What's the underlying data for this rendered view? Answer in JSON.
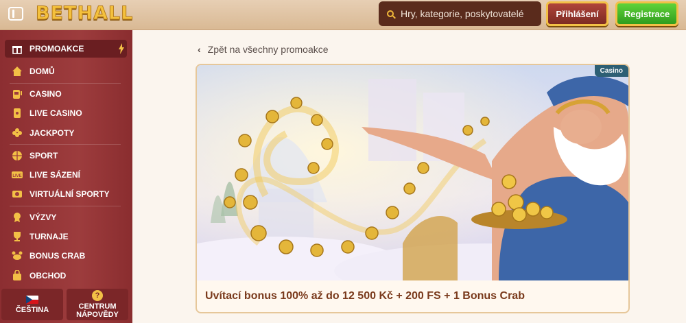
{
  "header": {
    "logo": "BETHALL",
    "search_placeholder": "Hry, kategorie, poskytovatelé",
    "login_label": "Přihlášení",
    "register_label": "Registrace"
  },
  "sidebar": {
    "items": [
      {
        "label": "PROMOAKCE",
        "icon": "gift-icon"
      },
      {
        "label": "DOMŮ",
        "icon": "home-icon"
      },
      {
        "label": "CASINO",
        "icon": "slot-machine-icon"
      },
      {
        "label": "LIVE CASINO",
        "icon": "cards-icon"
      },
      {
        "label": "JACKPOTY",
        "icon": "clover-icon"
      },
      {
        "label": "SPORT",
        "icon": "ball-icon"
      },
      {
        "label": "LIVE SÁZENÍ",
        "icon": "live-icon"
      },
      {
        "label": "VIRTUÁLNÍ SPORTY",
        "icon": "virtual-icon"
      },
      {
        "label": "VÝZVY",
        "icon": "challenge-icon"
      },
      {
        "label": "TURNAJE",
        "icon": "trophy-icon"
      },
      {
        "label": "BONUS CRAB",
        "icon": "crab-icon"
      },
      {
        "label": "OBCHOD",
        "icon": "bag-icon"
      }
    ],
    "language_label": "ČEŠTINA",
    "help_label_1": "CENTRUM",
    "help_label_2": "NÁPOVĚDY"
  },
  "main": {
    "back_link": "Zpět na všechny promoakce",
    "badge": "Casino",
    "promo_title": "Uvítací bonus 100% až do 12 500 Kč + 200 FS + 1 Bonus Crab"
  },
  "colors": {
    "accent_gold": "#f3c046",
    "sidebar": "#9d3c3d",
    "register_green": "#3fb329",
    "login_red": "#9c3a31"
  }
}
